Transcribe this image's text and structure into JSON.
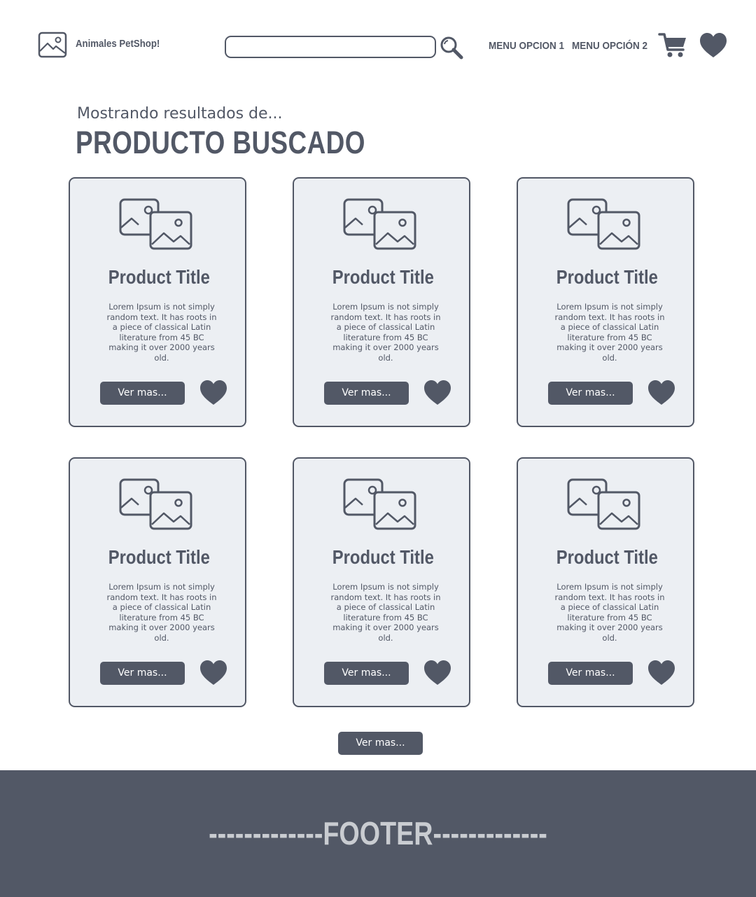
{
  "header": {
    "brand": "Animales PetShop!",
    "search": {
      "value": "",
      "placeholder": ""
    },
    "menu": [
      "MENU OPCION 1",
      "MENU OPCIÓN 2"
    ]
  },
  "results": {
    "subtitle": "Mostrando resultados de...",
    "title": "PRODUCTO BUSCADO"
  },
  "products": [
    {
      "title": "Product Title",
      "description": "Lorem Ipsum is not simply random text. It has roots in a piece of classical Latin literature from 45 BC making it over 2000 years old.",
      "button": "Ver mas..."
    },
    {
      "title": "Product Title",
      "description": "Lorem Ipsum is not simply random text. It has roots in a piece of classical Latin literature from 45 BC making it over 2000 years old.",
      "button": "Ver mas..."
    },
    {
      "title": "Product Title",
      "description": "Lorem Ipsum is not simply random text. It has roots in a piece of classical Latin literature from 45 BC making it over 2000 years old.",
      "button": "Ver mas..."
    },
    {
      "title": "Product Title",
      "description": "Lorem Ipsum is not simply random text. It has roots in a piece of classical Latin literature from 45 BC making it over 2000 years old.",
      "button": "Ver mas..."
    },
    {
      "title": "Product Title",
      "description": "Lorem Ipsum is not simply random text. It has roots in a piece of classical Latin literature from 45 BC making it over 2000 years old.",
      "button": "Ver mas..."
    },
    {
      "title": "Product Title",
      "description": "Lorem Ipsum is not simply random text. It has roots in a piece of classical Latin literature from 45 BC making it over 2000 years old.",
      "button": "Ver mas..."
    }
  ],
  "load_more": "Ver mas...",
  "footer": {
    "text": "-------------FOOTER-------------"
  },
  "icons": {
    "logo": "image-icon",
    "search": "search-icon",
    "cart": "cart-icon",
    "favorites": "heart-icon",
    "product_image": "images-icon"
  },
  "colors": {
    "primary": "#525866",
    "card_background": "#eceff3",
    "footer_background": "#525866",
    "footer_text": "#c9ccd1",
    "button_text": "#ffffff"
  }
}
